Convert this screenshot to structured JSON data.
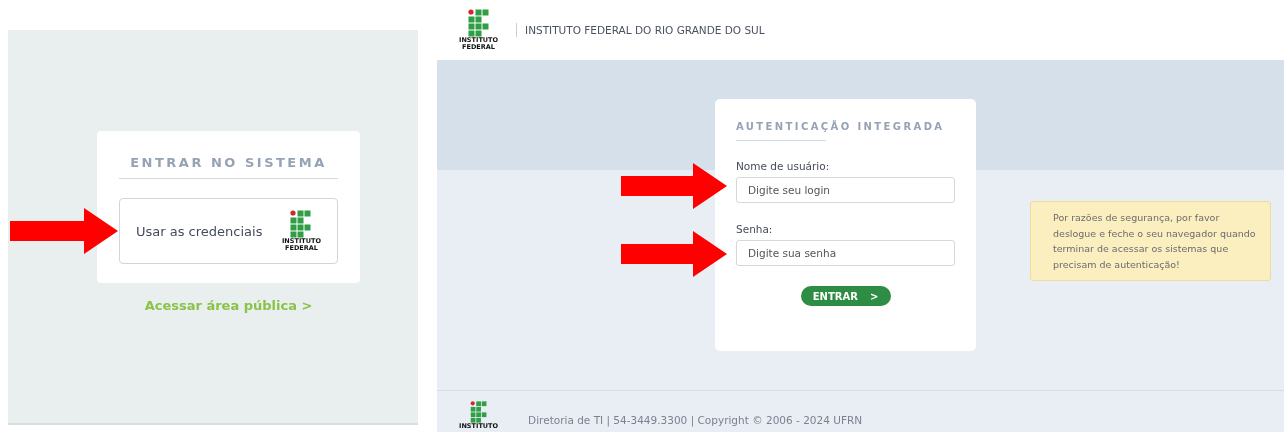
{
  "left_screen": {
    "card_title": "ENTRAR NO SISTEMA",
    "credentials_button": {
      "label": "Usar as credenciais",
      "logo_lines": [
        "INSTITUTO",
        "FEDERAL"
      ]
    },
    "public_link": {
      "label": "Acessar área pública",
      "chevron": ">"
    }
  },
  "right_screen": {
    "header": {
      "logo_lines": [
        "INSTITUTO",
        "FEDERAL"
      ],
      "title": "INSTITUTO FEDERAL DO RIO GRANDE DO SUL"
    },
    "login_card": {
      "title": "AUTENTICAÇÃO INTEGRADA",
      "fields": [
        {
          "label": "Nome de usuário:",
          "placeholder": "Digite seu login"
        },
        {
          "label": "Senha:",
          "placeholder": "Digite sua senha"
        }
      ],
      "submit": {
        "label": "ENTRAR",
        "chevron": ">"
      }
    },
    "notice": "Por razões de segurança, por favor deslogue e feche o seu navegador quando terminar de acessar os sistemas que precisam de autenticação!",
    "footer": {
      "logo_lines": [
        "INSTITUTO"
      ],
      "text": "Diretoria de TI | 54-3449.3300 | Copyright © 2006 - 2024 UFRN"
    }
  }
}
